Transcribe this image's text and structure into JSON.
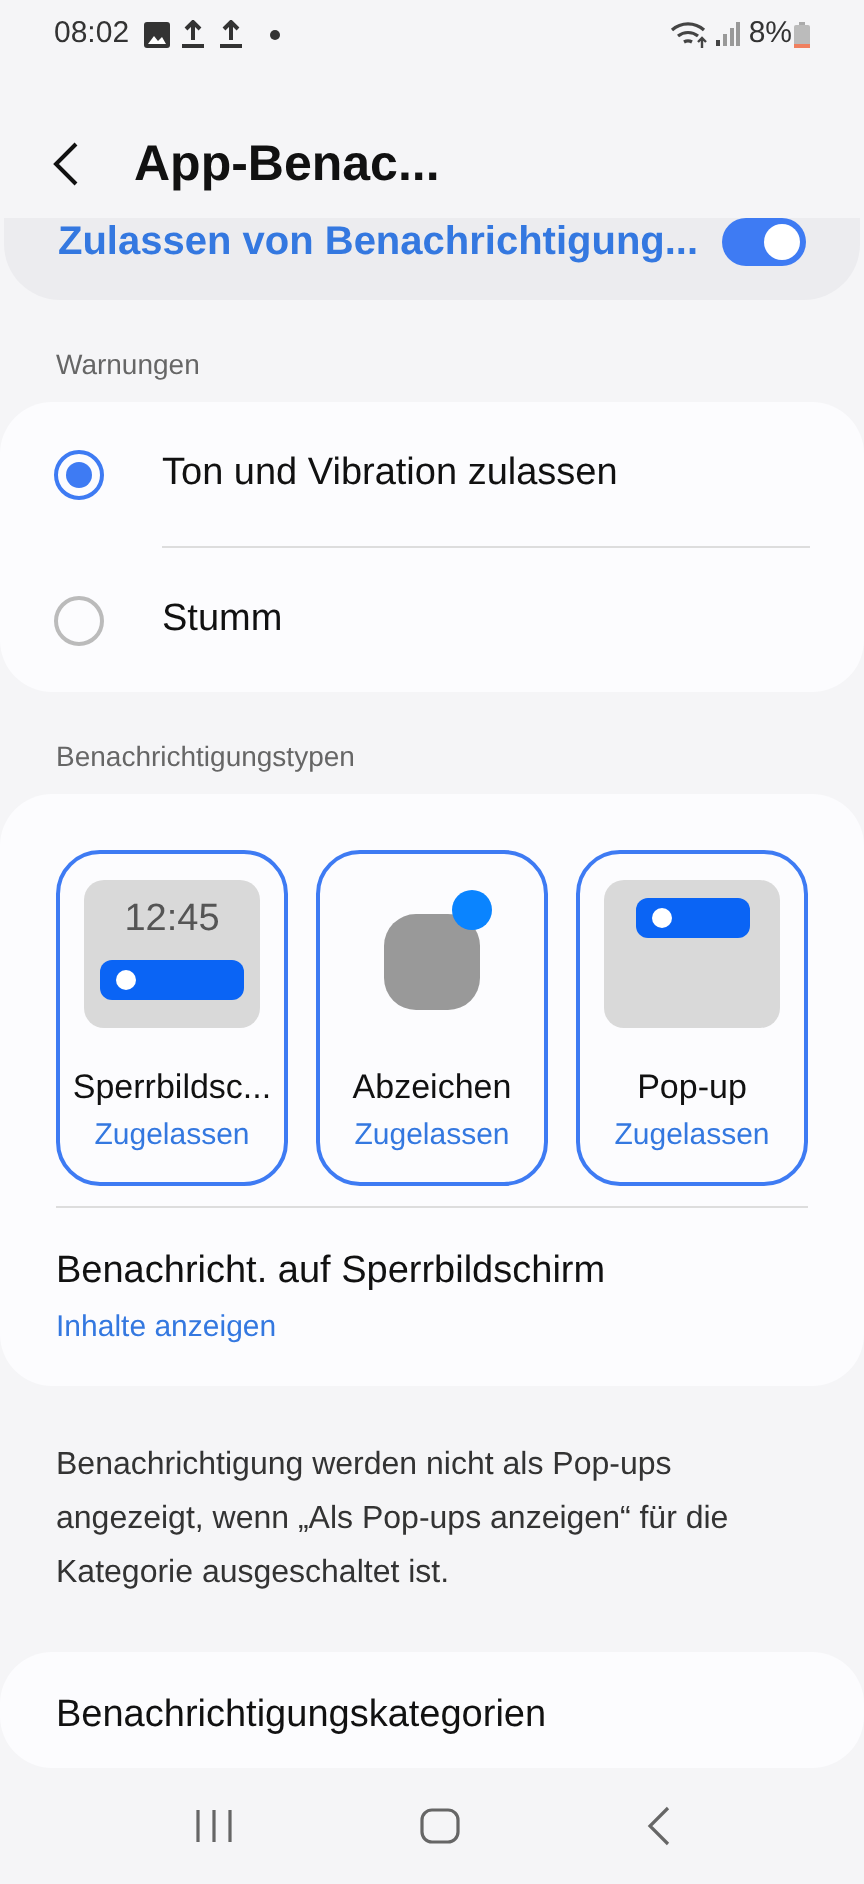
{
  "status_bar": {
    "time": "08:02",
    "battery": "8%"
  },
  "header": {
    "title": "App-Benac..."
  },
  "master_toggle": {
    "label": "Zulassen von Benachrichtigung...",
    "on": true
  },
  "alerts": {
    "heading": "Warnungen",
    "options": [
      {
        "label": "Ton und Vibration zulassen",
        "selected": true
      },
      {
        "label": "Stumm",
        "selected": false
      }
    ]
  },
  "types": {
    "heading": "Benachrichtigungstypen",
    "tiles": [
      {
        "kind": "lockscreen",
        "preview_time": "12:45",
        "label": "Sperrbildsc...",
        "status": "Zugelassen"
      },
      {
        "kind": "badge",
        "label": "Abzeichen",
        "status": "Zugelassen"
      },
      {
        "kind": "popup",
        "label": "Pop-up",
        "status": "Zugelassen"
      }
    ],
    "lockscreen_row": {
      "title": "Benachricht. auf Sperrbildschirm",
      "value": "Inhalte anzeigen"
    }
  },
  "note": "Benachrichtigung werden nicht als Pop-ups angezeigt, wenn „Als Pop-ups anzeigen“ für die Kategorie ausgeschaltet ist.",
  "categories": {
    "title": "Benachrichtigungskategorien"
  }
}
